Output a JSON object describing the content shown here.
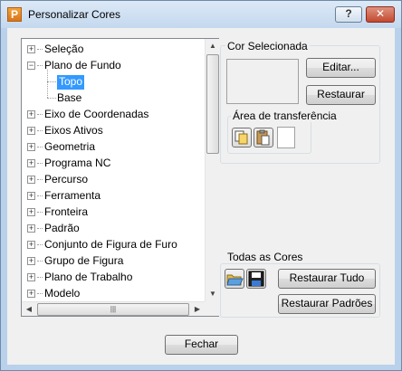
{
  "window": {
    "title": "Personalizar Cores",
    "app_icon": "P",
    "help_label": "?",
    "close_label": "✕"
  },
  "tree": {
    "items": [
      {
        "label": "Seleção",
        "level": 0,
        "expander": "+"
      },
      {
        "label": "Plano de Fundo",
        "level": 0,
        "expander": "−"
      },
      {
        "label": "Topo",
        "level": 1,
        "selected": true
      },
      {
        "label": "Base",
        "level": 1
      },
      {
        "label": "Eixo de Coordenadas",
        "level": 0,
        "expander": "+"
      },
      {
        "label": "Eixos Ativos",
        "level": 0,
        "expander": "+"
      },
      {
        "label": "Geometria",
        "level": 0,
        "expander": "+"
      },
      {
        "label": "Programa NC",
        "level": 0,
        "expander": "+"
      },
      {
        "label": "Percurso",
        "level": 0,
        "expander": "+"
      },
      {
        "label": "Ferramenta",
        "level": 0,
        "expander": "+"
      },
      {
        "label": "Fronteira",
        "level": 0,
        "expander": "+"
      },
      {
        "label": "Padrão",
        "level": 0,
        "expander": "+"
      },
      {
        "label": "Conjunto de Figura de Furo",
        "level": 0,
        "expander": "+"
      },
      {
        "label": "Grupo de Figura",
        "level": 0,
        "expander": "+"
      },
      {
        "label": "Plano de Trabalho",
        "level": 0,
        "expander": "+"
      },
      {
        "label": "Modelo",
        "level": 0,
        "expander": "+"
      }
    ],
    "scroll_up": "▲",
    "scroll_down": "▼",
    "scroll_left": "◀",
    "scroll_right": "▶",
    "hthumb_grip": "|||"
  },
  "selected_color": {
    "group_label": "Cor Selecionada",
    "edit_button": "Editar...",
    "restore_button": "Restaurar",
    "clipboard_label": "Área de transferência",
    "copy_icon": "copy-icon",
    "paste_icon": "paste-icon"
  },
  "all_colors": {
    "group_label": "Todas as Cores",
    "open_icon": "folder-open-icon",
    "save_icon": "save-icon",
    "restore_all_button": "Restaurar Tudo",
    "restore_defaults_button": "Restaurar Padrões"
  },
  "footer": {
    "close_button": "Fechar"
  },
  "colors": {
    "selection_highlight": "#3399ff",
    "dialog_bg": "#f0f0f0",
    "titlebar": "#c4d8ee"
  }
}
